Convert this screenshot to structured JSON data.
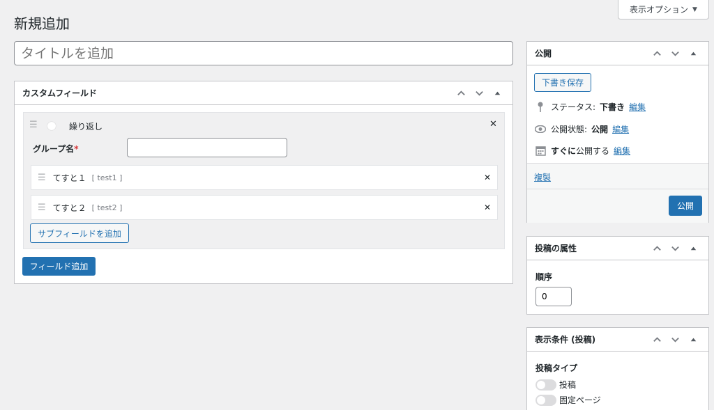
{
  "screen_options": {
    "label": "表示オプション"
  },
  "page": {
    "title": "新規追加",
    "title_placeholder": "タイトルを追加"
  },
  "custom_fields": {
    "title": "カスタムフィールド",
    "repeat_label": "繰り返し",
    "group_name_label": "グループ名",
    "required_mark": "*",
    "group_name_value": "",
    "subfields": [
      {
        "label": "てすと１",
        "key": "[ test1 ]"
      },
      {
        "label": "てすと２",
        "key": "[ test2 ]"
      }
    ],
    "add_subfield_label": "サブフィールドを追加",
    "add_field_label": "フィールド追加"
  },
  "publish": {
    "title": "公開",
    "save_draft_label": "下書き保存",
    "status_label": "ステータス:",
    "status_value": "下書き",
    "visibility_label": "公開状態:",
    "visibility_value": "公開",
    "schedule_strong": "すぐに",
    "schedule_text": "公開する",
    "edit_label": "編集",
    "duplicate_label": "複製",
    "publish_button_label": "公開"
  },
  "attributes": {
    "title": "投稿の属性",
    "order_label": "順序",
    "order_value": "0"
  },
  "display_conditions": {
    "title": "表示条件 (投稿)",
    "post_type_label": "投稿タイプ",
    "options": [
      "投稿",
      "固定ページ"
    ]
  },
  "icons": {
    "drag": "drag-handle-icon",
    "close": "close-icon",
    "pin": "pin-icon",
    "eye": "eye-icon",
    "calendar": "calendar-icon",
    "up": "chevron-up-icon",
    "down": "chevron-down-icon",
    "toggle": "triangle-up-icon"
  },
  "colors": {
    "primary": "#2271b1",
    "background": "#f0f0f1",
    "required": "#d63638"
  }
}
